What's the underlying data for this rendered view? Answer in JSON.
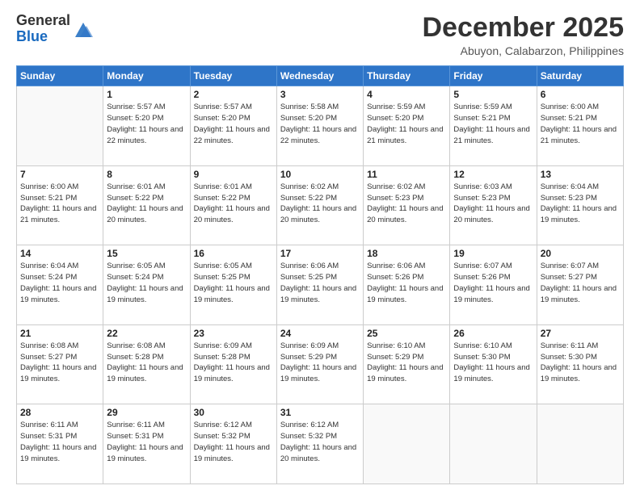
{
  "header": {
    "logo_general": "General",
    "logo_blue": "Blue",
    "month_title": "December 2025",
    "location": "Abuyon, Calabarzon, Philippines"
  },
  "days_of_week": [
    "Sunday",
    "Monday",
    "Tuesday",
    "Wednesday",
    "Thursday",
    "Friday",
    "Saturday"
  ],
  "weeks": [
    [
      {
        "day": "",
        "info": ""
      },
      {
        "day": "1",
        "info": "Sunrise: 5:57 AM\nSunset: 5:20 PM\nDaylight: 11 hours\nand 22 minutes."
      },
      {
        "day": "2",
        "info": "Sunrise: 5:57 AM\nSunset: 5:20 PM\nDaylight: 11 hours\nand 22 minutes."
      },
      {
        "day": "3",
        "info": "Sunrise: 5:58 AM\nSunset: 5:20 PM\nDaylight: 11 hours\nand 22 minutes."
      },
      {
        "day": "4",
        "info": "Sunrise: 5:59 AM\nSunset: 5:20 PM\nDaylight: 11 hours\nand 21 minutes."
      },
      {
        "day": "5",
        "info": "Sunrise: 5:59 AM\nSunset: 5:21 PM\nDaylight: 11 hours\nand 21 minutes."
      },
      {
        "day": "6",
        "info": "Sunrise: 6:00 AM\nSunset: 5:21 PM\nDaylight: 11 hours\nand 21 minutes."
      }
    ],
    [
      {
        "day": "7",
        "info": ""
      },
      {
        "day": "8",
        "info": "Sunrise: 6:01 AM\nSunset: 5:22 PM\nDaylight: 11 hours\nand 20 minutes."
      },
      {
        "day": "9",
        "info": "Sunrise: 6:01 AM\nSunset: 5:22 PM\nDaylight: 11 hours\nand 20 minutes."
      },
      {
        "day": "10",
        "info": "Sunrise: 6:02 AM\nSunset: 5:22 PM\nDaylight: 11 hours\nand 20 minutes."
      },
      {
        "day": "11",
        "info": "Sunrise: 6:02 AM\nSunset: 5:23 PM\nDaylight: 11 hours\nand 20 minutes."
      },
      {
        "day": "12",
        "info": "Sunrise: 6:03 AM\nSunset: 5:23 PM\nDaylight: 11 hours\nand 20 minutes."
      },
      {
        "day": "13",
        "info": "Sunrise: 6:04 AM\nSunset: 5:23 PM\nDaylight: 11 hours\nand 19 minutes."
      }
    ],
    [
      {
        "day": "14",
        "info": ""
      },
      {
        "day": "15",
        "info": "Sunrise: 6:05 AM\nSunset: 5:24 PM\nDaylight: 11 hours\nand 19 minutes."
      },
      {
        "day": "16",
        "info": "Sunrise: 6:05 AM\nSunset: 5:25 PM\nDaylight: 11 hours\nand 19 minutes."
      },
      {
        "day": "17",
        "info": "Sunrise: 6:06 AM\nSunset: 5:25 PM\nDaylight: 11 hours\nand 19 minutes."
      },
      {
        "day": "18",
        "info": "Sunrise: 6:06 AM\nSunset: 5:26 PM\nDaylight: 11 hours\nand 19 minutes."
      },
      {
        "day": "19",
        "info": "Sunrise: 6:07 AM\nSunset: 5:26 PM\nDaylight: 11 hours\nand 19 minutes."
      },
      {
        "day": "20",
        "info": "Sunrise: 6:07 AM\nSunset: 5:27 PM\nDaylight: 11 hours\nand 19 minutes."
      }
    ],
    [
      {
        "day": "21",
        "info": ""
      },
      {
        "day": "22",
        "info": "Sunrise: 6:08 AM\nSunset: 5:28 PM\nDaylight: 11 hours\nand 19 minutes."
      },
      {
        "day": "23",
        "info": "Sunrise: 6:09 AM\nSunset: 5:28 PM\nDaylight: 11 hours\nand 19 minutes."
      },
      {
        "day": "24",
        "info": "Sunrise: 6:09 AM\nSunset: 5:29 PM\nDaylight: 11 hours\nand 19 minutes."
      },
      {
        "day": "25",
        "info": "Sunrise: 6:10 AM\nSunset: 5:29 PM\nDaylight: 11 hours\nand 19 minutes."
      },
      {
        "day": "26",
        "info": "Sunrise: 6:10 AM\nSunset: 5:30 PM\nDaylight: 11 hours\nand 19 minutes."
      },
      {
        "day": "27",
        "info": "Sunrise: 6:11 AM\nSunset: 5:30 PM\nDaylight: 11 hours\nand 19 minutes."
      }
    ],
    [
      {
        "day": "28",
        "info": "Sunrise: 6:11 AM\nSunset: 5:31 PM\nDaylight: 11 hours\nand 19 minutes."
      },
      {
        "day": "29",
        "info": "Sunrise: 6:11 AM\nSunset: 5:31 PM\nDaylight: 11 hours\nand 19 minutes."
      },
      {
        "day": "30",
        "info": "Sunrise: 6:12 AM\nSunset: 5:32 PM\nDaylight: 11 hours\nand 19 minutes."
      },
      {
        "day": "31",
        "info": "Sunrise: 6:12 AM\nSunset: 5:32 PM\nDaylight: 11 hours\nand 20 minutes."
      },
      {
        "day": "",
        "info": ""
      },
      {
        "day": "",
        "info": ""
      },
      {
        "day": "",
        "info": ""
      }
    ]
  ],
  "week7_sunday": "Sunrise: 6:00 AM\nSunset: 5:21 PM\nDaylight: 11 hours\nand 21 minutes.",
  "week14_sunday": "Sunrise: 6:04 AM\nSunset: 5:24 PM\nDaylight: 11 hours\nand 19 minutes.",
  "week21_sunday": "Sunrise: 6:08 AM\nSunset: 5:27 PM\nDaylight: 11 hours\nand 19 minutes."
}
